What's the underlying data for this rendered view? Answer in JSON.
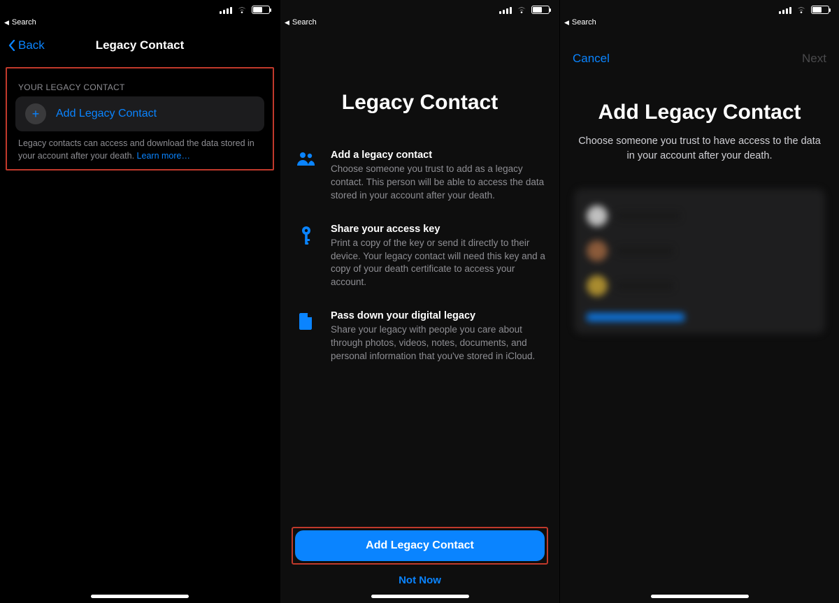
{
  "colors": {
    "accent": "#0a84ff",
    "highlight": "#c0392b"
  },
  "status": {
    "breadcrumb": "Search"
  },
  "screen1": {
    "back": "Back",
    "title": "Legacy Contact",
    "sectionHeader": "YOUR LEGACY CONTACT",
    "addLabel": "Add Legacy Contact",
    "footer": "Legacy contacts can access and download the data stored in your account after your death. ",
    "learnMore": "Learn more…"
  },
  "screen2": {
    "title": "Legacy Contact",
    "items": [
      {
        "heading": "Add a legacy contact",
        "desc": "Choose someone you trust to add as a legacy contact. This person will be able to access the data stored in your account after your death."
      },
      {
        "heading": "Share your access key",
        "desc": "Print a copy of the key or send it directly to their device. Your legacy contact will need this key and a copy of your death certificate to access your account."
      },
      {
        "heading": "Pass down your digital legacy",
        "desc": "Share your legacy with people you care about through photos, videos, notes, documents, and personal information that you've stored in iCloud."
      }
    ],
    "primary": "Add Legacy Contact",
    "secondary": "Not Now"
  },
  "screen3": {
    "cancel": "Cancel",
    "next": "Next",
    "title": "Add Legacy Contact",
    "subtitle": "Choose someone you trust to have access to the data in your account after your death."
  }
}
